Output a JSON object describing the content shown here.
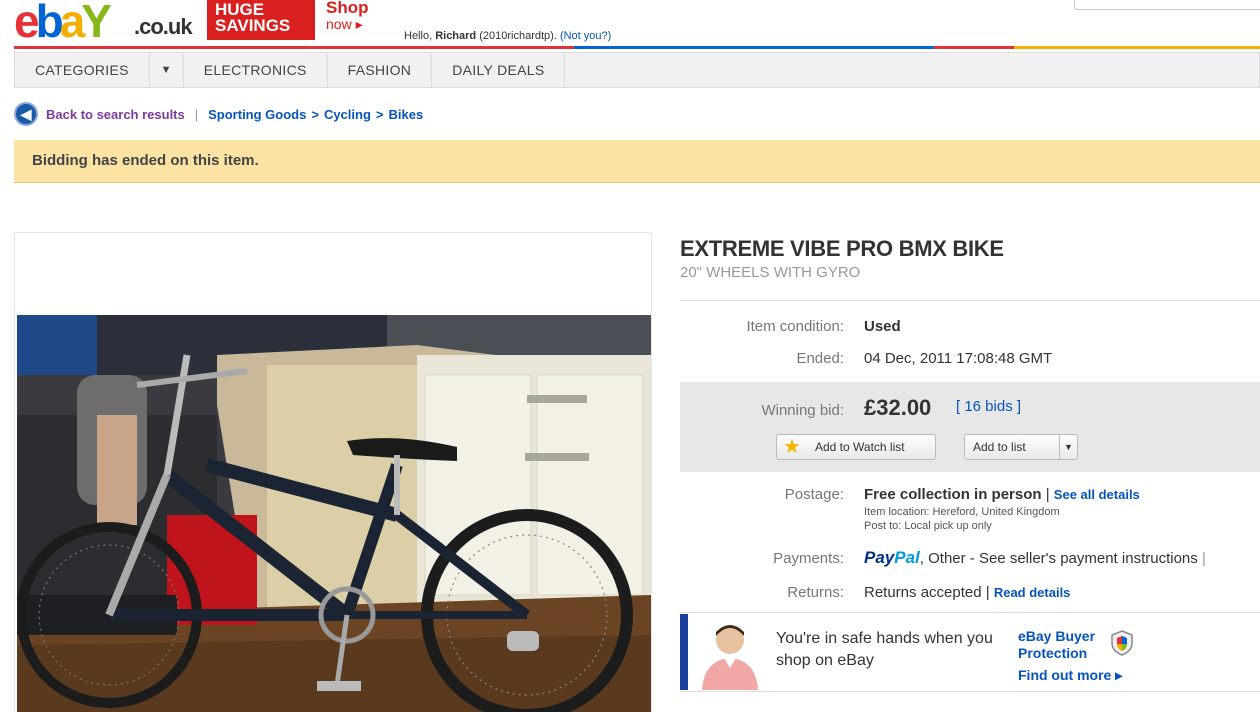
{
  "header": {
    "logo": {
      "e": "e",
      "b": "b",
      "a": "a",
      "y": "Y",
      "suffix": ".co.uk"
    },
    "promo": {
      "line1": "HUGE",
      "line2": "SAVINGS"
    },
    "shop_now": {
      "line1": "Shop",
      "line2": "now ▸"
    },
    "greeting": {
      "prefix": "Hello,",
      "name": "Richard",
      "username": "(2010richardtp).",
      "not_you": "(Not you?)"
    },
    "colors": {
      "red": "#e53238",
      "blue": "#0064d2",
      "yellow": "#f5af02",
      "green": "#86b817"
    }
  },
  "nav": {
    "categories": "Categories",
    "caret": "▼",
    "electronics": "Electronics",
    "fashion": "Fashion",
    "daily_deals": "Daily Deals"
  },
  "breadcrumb": {
    "back_icon": "back-arrow-icon",
    "back": "Back to search results",
    "sep": "|",
    "crumb1": "Sporting Goods",
    "arrow": ">",
    "crumb2": "Cycling",
    "crumb3": "Bikes"
  },
  "notice": {
    "text": "Bidding has ended on this item."
  },
  "item": {
    "title": "EXTREME VIBE PRO BMX BIKE",
    "subtitle": "20\" WHEELS WITH GYRO",
    "condition_label": "Item condition:",
    "condition_value": "Used",
    "ended_label": "Ended:",
    "ended_value": "04 Dec, 2011 17:08:48 GMT",
    "winning_label": "Winning bid:",
    "price": "£32.00",
    "bids": "[ 16 bids ]",
    "watch_button": "Add to Watch list",
    "list_button": "Add to list",
    "postage_label": "Postage:",
    "postage_value": "Free collection in person",
    "postage_sep": "|",
    "postage_link": "See all details",
    "item_location": "Item location: Hereford, United Kingdom",
    "post_to": "Post to: Local pick up only",
    "payments_label": "Payments:",
    "paypal_pay": "Pay",
    "paypal_pal": "Pal",
    "payments_rest": ", Other - See seller's payment instructions",
    "payments_sep": "|",
    "returns_label": "Returns:",
    "returns_value": "Returns accepted",
    "returns_sep": "|",
    "returns_link": "Read details"
  },
  "protection": {
    "safe_text": "You're in safe hands when you shop on eBay",
    "title_line1": "eBay Buyer",
    "title_line2": "Protection",
    "find_out": "Find out more ▸",
    "accent": "#1a3f9a"
  }
}
